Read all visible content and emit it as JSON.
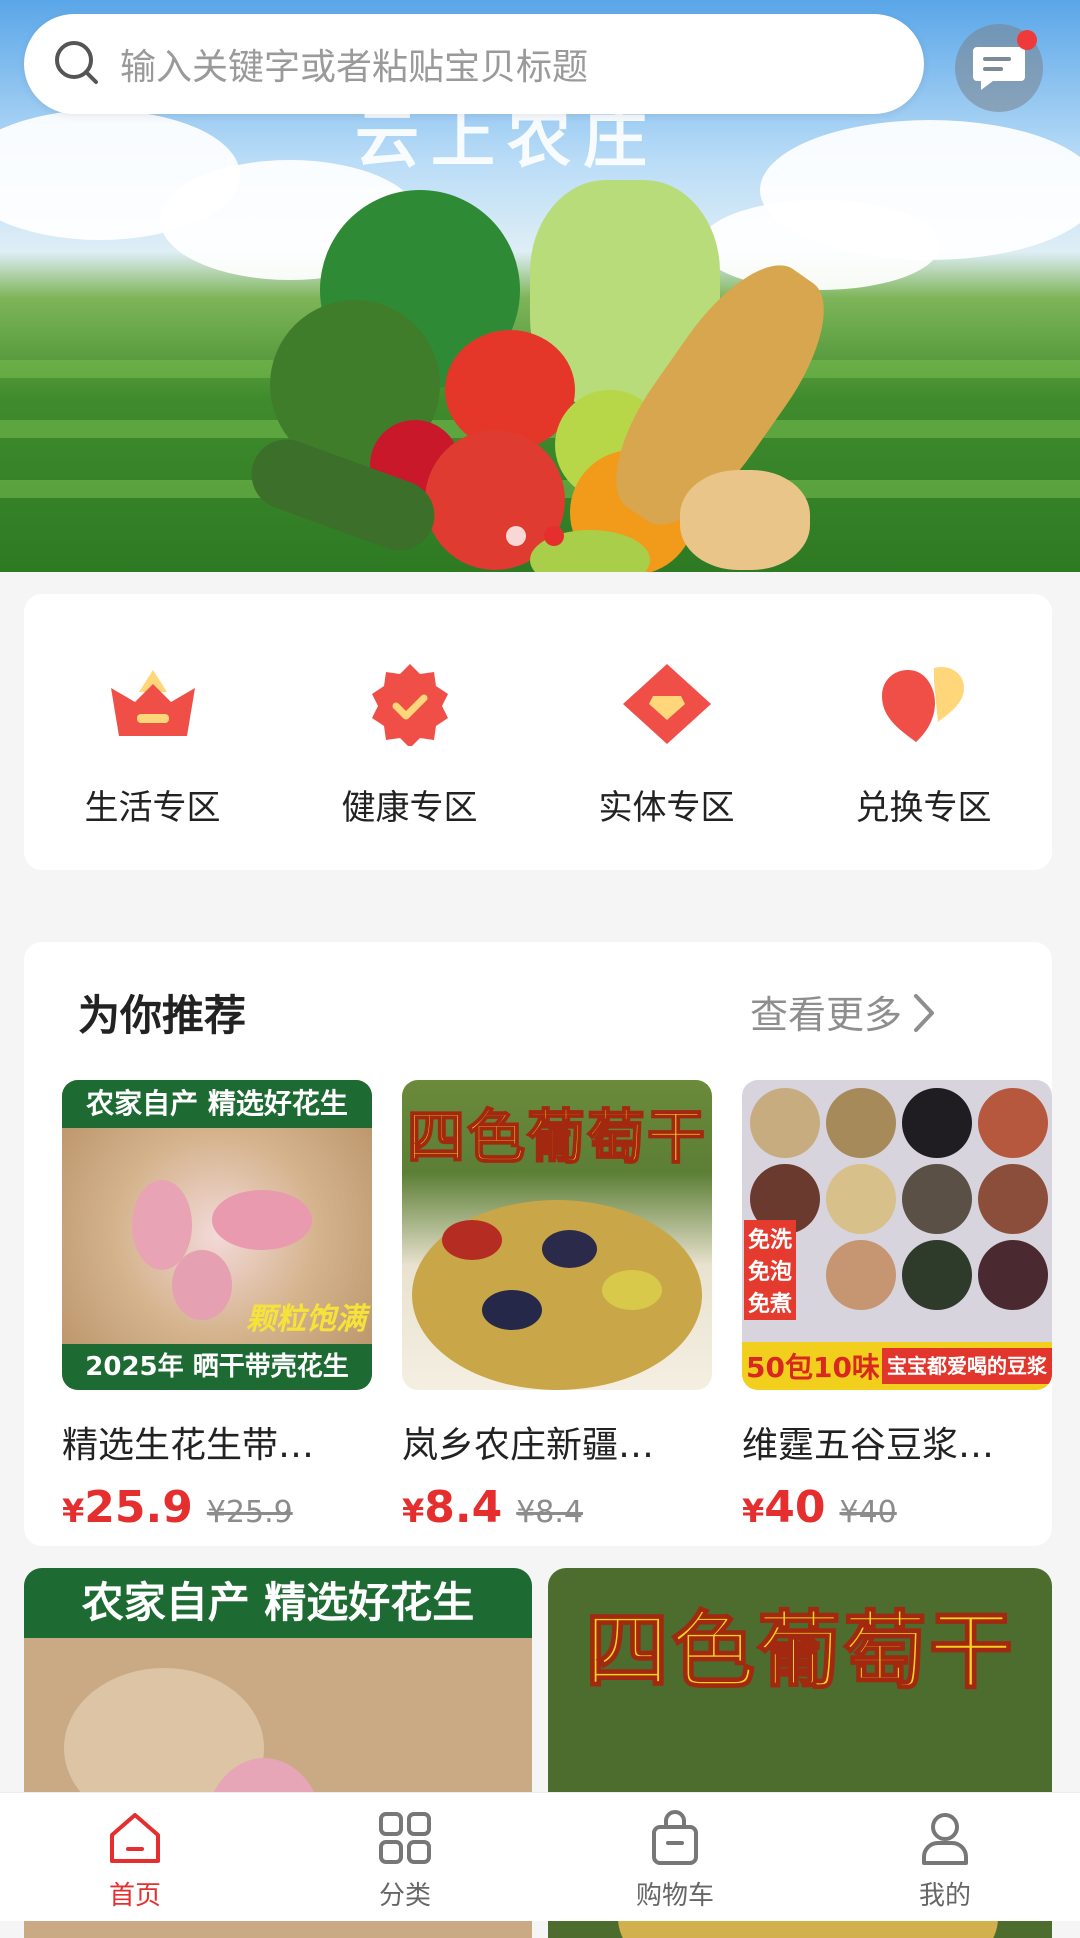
{
  "search": {
    "placeholder": "输入关键字或者粘贴宝贝标题"
  },
  "banner": {
    "headline": "云上农庄",
    "slide_count": 2,
    "active_slide": 2
  },
  "categories": [
    {
      "label": "生活专区",
      "icon": "crown-icon"
    },
    {
      "label": "健康专区",
      "icon": "badge-check-icon"
    },
    {
      "label": "实体专区",
      "icon": "diamond-icon"
    },
    {
      "label": "兑换专区",
      "icon": "heart-icon"
    }
  ],
  "recommend": {
    "title": "为你推荐",
    "more_label": "查看更多",
    "products": [
      {
        "name": "精选生花生带…",
        "currency": "¥",
        "price": "25.9",
        "original_price": "¥25.9",
        "image_texts": {
          "top": "农家自产 精选好花生",
          "badge": "颗粒饱满",
          "bottom": "2025年 晒干带壳花生"
        }
      },
      {
        "name": "岚乡农庄新疆…",
        "currency": "¥",
        "price": "8.4",
        "original_price": "¥8.4",
        "image_texts": {
          "top": "四色葡萄干"
        }
      },
      {
        "name": "维霆五谷豆浆…",
        "currency": "¥",
        "price": "40",
        "original_price": "¥40",
        "image_texts": {
          "tags": [
            "免洗",
            "免泡",
            "免煮"
          ],
          "bottom_left": "50包10味",
          "bottom_right": "宝宝都爱喝的豆浆"
        }
      }
    ]
  },
  "feed": [
    {
      "image_text": "农家自产 精选好花生"
    },
    {
      "image_text": "四色葡萄干"
    }
  ],
  "tabbar": {
    "active": "home",
    "items": [
      {
        "key": "home",
        "label": "首页",
        "icon": "home-icon"
      },
      {
        "key": "category",
        "label": "分类",
        "icon": "grid-icon"
      },
      {
        "key": "cart",
        "label": "购物车",
        "icon": "shopping-bag-icon"
      },
      {
        "key": "me",
        "label": "我的",
        "icon": "user-icon"
      }
    ]
  },
  "colors": {
    "accent": "#e52f2f",
    "icon_red": "#f04f48",
    "icon_yellow": "#ffd77a"
  }
}
